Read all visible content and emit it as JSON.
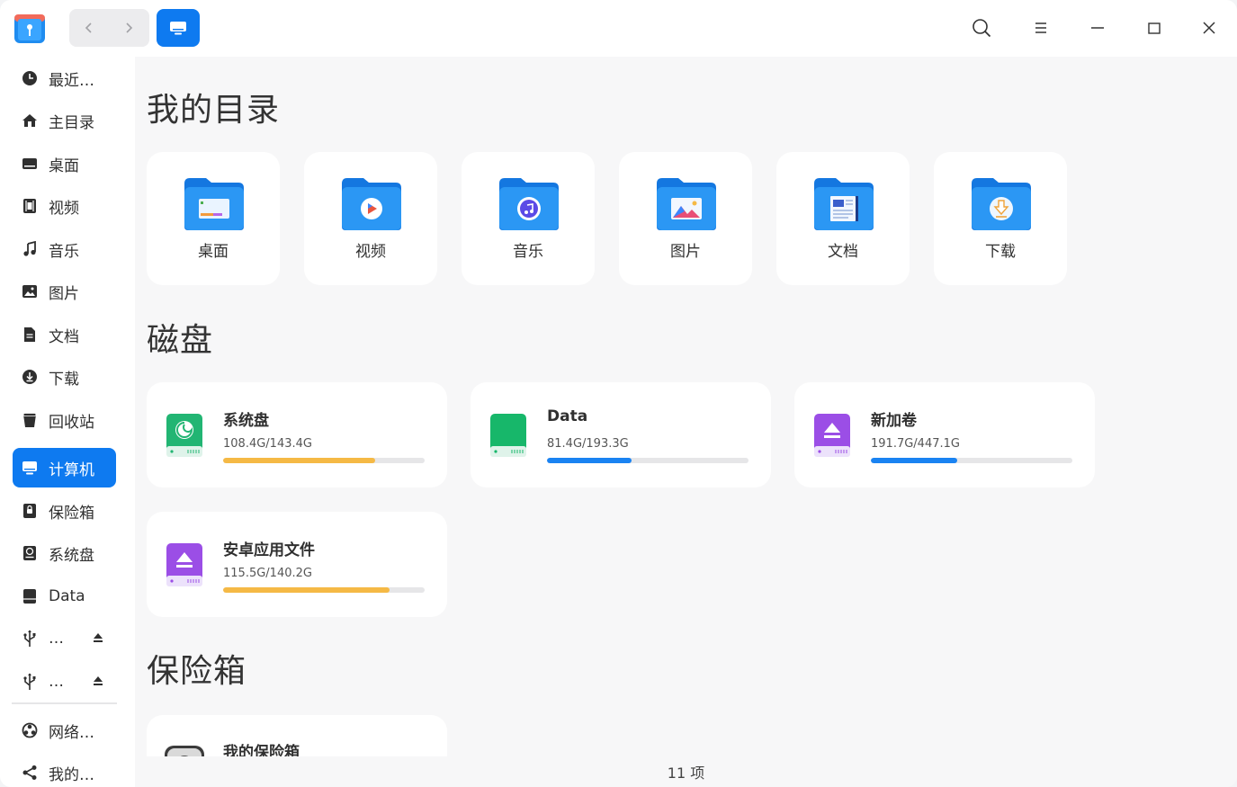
{
  "window": {
    "toolbar": {
      "back_icon": "chevron-left-icon",
      "forward_icon": "chevron-right-icon",
      "view_icon": "computer-icon",
      "search_icon": "search-icon",
      "menu_icon": "hamburger-menu-icon",
      "minimize_icon": "minimize-icon",
      "maximize_icon": "maximize-icon",
      "close_icon": "close-icon"
    }
  },
  "sidebar": {
    "items": [
      {
        "label": "最近…",
        "icon": "clock-icon"
      },
      {
        "label": "主目录",
        "icon": "home-icon"
      },
      {
        "label": "桌面",
        "icon": "desktop-icon"
      },
      {
        "label": "视频",
        "icon": "film-icon"
      },
      {
        "label": "音乐",
        "icon": "music-note-icon"
      },
      {
        "label": "图片",
        "icon": "image-icon"
      },
      {
        "label": "文档",
        "icon": "document-icon"
      },
      {
        "label": "下载",
        "icon": "download-icon"
      },
      {
        "label": "回收站",
        "icon": "trash-icon"
      },
      {
        "label": "计算机",
        "icon": "computer-icon",
        "active": true
      },
      {
        "label": "保险箱",
        "icon": "vault-icon"
      },
      {
        "label": "系统盘",
        "icon": "system-disk-icon"
      },
      {
        "label": "Data",
        "icon": "disk-icon"
      },
      {
        "label": "…",
        "icon": "usb-icon"
      },
      {
        "label": "…",
        "icon": "usb-icon"
      },
      {
        "label": "网络…",
        "icon": "network-icon"
      },
      {
        "label": "我的…",
        "icon": "share-icon"
      }
    ]
  },
  "main": {
    "my_dirs_title": "我的目录",
    "dirs": [
      {
        "label": "桌面",
        "icon": "desktop-folder-icon"
      },
      {
        "label": "视频",
        "icon": "video-folder-icon"
      },
      {
        "label": "音乐",
        "icon": "music-folder-icon"
      },
      {
        "label": "图片",
        "icon": "pictures-folder-icon"
      },
      {
        "label": "文档",
        "icon": "documents-folder-icon"
      },
      {
        "label": "下载",
        "icon": "downloads-folder-icon"
      }
    ],
    "disks_title": "磁盘",
    "disks": [
      {
        "name": "系统盘",
        "size": "108.4G/143.4G",
        "used_fraction": 0.756,
        "bar_color": "#f5b945",
        "icon": "system-disk-icon"
      },
      {
        "name": "Data",
        "size": "81.4G/193.3G",
        "used_fraction": 0.421,
        "bar_color": "#1a83f2",
        "icon": "data-disk-icon"
      },
      {
        "name": "新加卷",
        "size": "191.7G/447.1G",
        "used_fraction": 0.429,
        "bar_color": "#1a83f2",
        "icon": "removable-disk-icon"
      },
      {
        "name": "安卓应用文件",
        "size": "115.5G/140.2G",
        "used_fraction": 0.824,
        "bar_color": "#f5b945",
        "icon": "removable-disk-icon"
      }
    ],
    "vault_title": "保险箱",
    "vault": {
      "name": "我的保险箱",
      "icon": "vault-icon"
    }
  },
  "status": {
    "item_count": "11 项"
  }
}
